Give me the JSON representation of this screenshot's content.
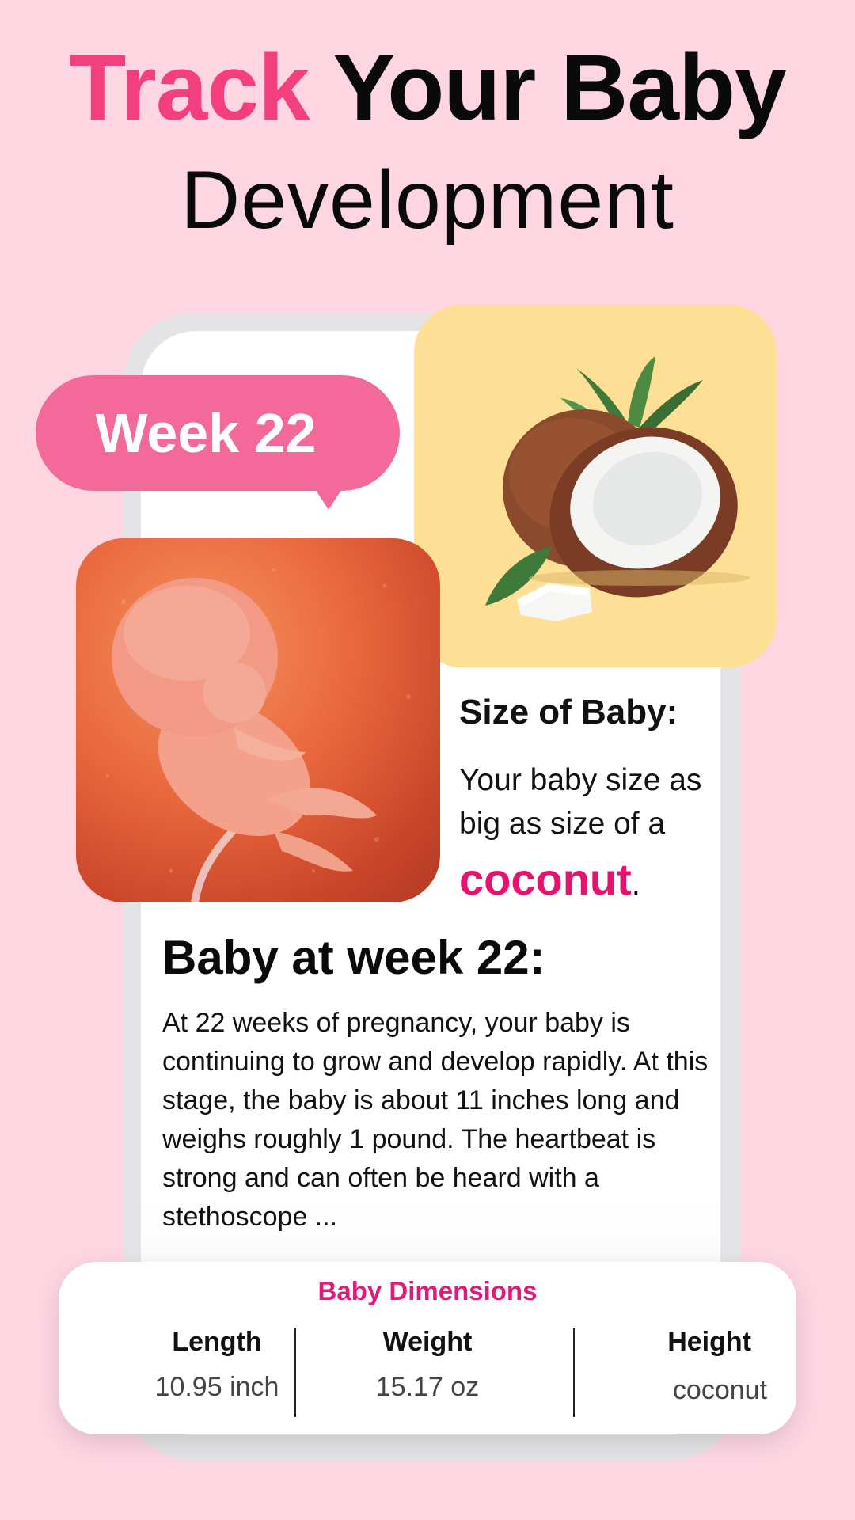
{
  "headline": {
    "accent_word": "Track",
    "rest_line1": "Your Baby",
    "line2": "Development"
  },
  "week_badge": {
    "label": "Week 22"
  },
  "size_section": {
    "title": "Size of Baby:",
    "description": "Your baby size as big as size of a",
    "fruit": "coconut",
    "fruit_suffix": "."
  },
  "article": {
    "title": "Baby at week 22:",
    "body": "At 22 weeks of pregnancy, your baby is continuing to grow and develop rapidly. At this stage, the baby is about 11 inches long and weighs roughly 1 pound. The heartbeat is strong and can often be heard with a stethoscope ..."
  },
  "dimensions": {
    "title": "Baby Dimensions",
    "items": [
      {
        "label": "Length",
        "value": "10.95 inch"
      },
      {
        "label": "Weight",
        "value": "15.17 oz"
      },
      {
        "label": "Height",
        "value": "coconut"
      }
    ]
  },
  "colors": {
    "background": "#fdd6e2",
    "accent_pink": "#f43f7f",
    "badge_pink": "#f2699a",
    "fruit_magenta": "#e8126e",
    "coconut_card": "#fde095"
  },
  "icons": {
    "fruit_illustration": "coconut-illustration",
    "baby_illustration": "fetus-illustration"
  }
}
